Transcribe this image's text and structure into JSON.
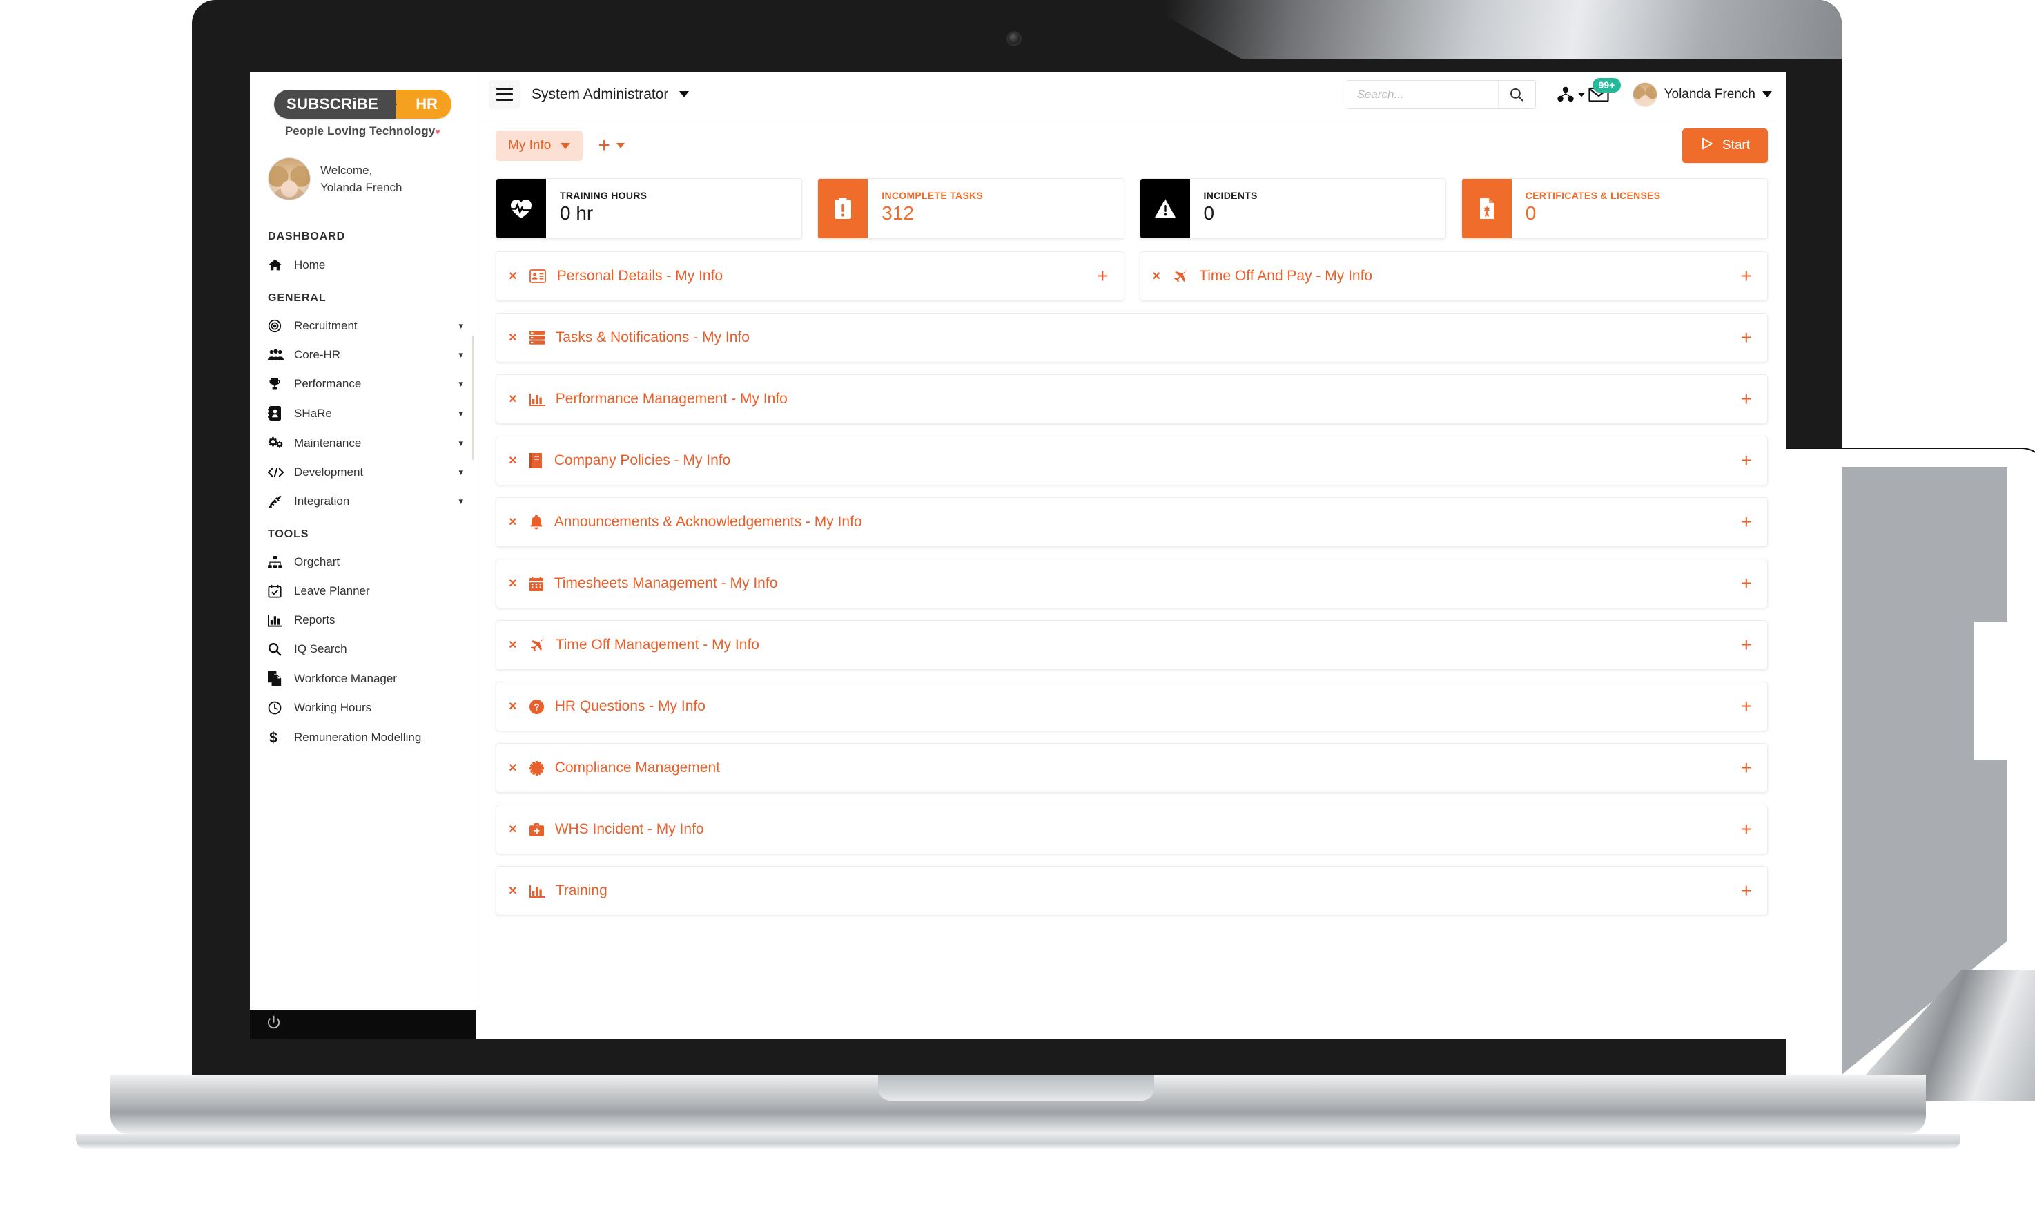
{
  "brand": {
    "logo_left": "SUBSCRiBE",
    "logo_right": "HR",
    "tagline": "People Loving Technology"
  },
  "welcome": {
    "greeting": "Welcome,",
    "user": "Yolanda French"
  },
  "sidebar": {
    "sections": [
      {
        "heading": "DASHBOARD",
        "items": [
          {
            "label": "Home",
            "icon": "home-icon",
            "expandable": false
          }
        ]
      },
      {
        "heading": "GENERAL",
        "items": [
          {
            "label": "Recruitment",
            "icon": "target-icon",
            "expandable": true
          },
          {
            "label": "Core-HR",
            "icon": "users-icon",
            "expandable": true
          },
          {
            "label": "Performance",
            "icon": "trophy-icon",
            "expandable": true
          },
          {
            "label": "SHaRe",
            "icon": "contact-card-icon",
            "expandable": true
          },
          {
            "label": "Maintenance",
            "icon": "gears-icon",
            "expandable": true
          },
          {
            "label": "Development",
            "icon": "code-icon",
            "expandable": true
          },
          {
            "label": "Integration",
            "icon": "plug-icon",
            "expandable": true
          }
        ]
      },
      {
        "heading": "TOOLS",
        "items": [
          {
            "label": "Orgchart",
            "icon": "org-tree-icon",
            "expandable": false
          },
          {
            "label": "Leave Planner",
            "icon": "calendar-check-icon",
            "expandable": false
          },
          {
            "label": "Reports",
            "icon": "bar-chart-icon",
            "expandable": false
          },
          {
            "label": "IQ Search",
            "icon": "magnifier-icon",
            "expandable": false
          },
          {
            "label": "Workforce Manager",
            "icon": "documents-icon",
            "expandable": false
          },
          {
            "label": "Working Hours",
            "icon": "clock-icon",
            "expandable": false
          },
          {
            "label": "Remuneration Modelling",
            "icon": "dollar-icon",
            "expandable": false
          }
        ]
      }
    ],
    "footer_icon": "power-icon"
  },
  "topbar": {
    "menu_icon": "hamburger-icon",
    "context_title": "System Administrator",
    "search": {
      "placeholder": "Search...",
      "value": "",
      "icon": "search-icon"
    },
    "apps_icon": "modules-icon",
    "mail_icon": "envelope-icon",
    "notification_badge": "99+",
    "user_name": "Yolanda French",
    "user_avatar": "avatar"
  },
  "toolbar": {
    "active_tab": "My Info",
    "add_label": "+",
    "start_label": "Start",
    "start_icon": "play-icon",
    "start_color": "#ef6c2b"
  },
  "stats": [
    {
      "label": "TRAINING HOURS",
      "value": "0 hr",
      "icon": "heartbeat-icon",
      "theme": "dark"
    },
    {
      "label": "INCOMPLETE TASKS",
      "value": "312",
      "icon": "clipboard-alert-icon",
      "theme": "orange"
    },
    {
      "label": "INCIDENTS",
      "value": "0",
      "icon": "warning-triangle-icon",
      "theme": "dark"
    },
    {
      "label": "CERTIFICATES & LICENSES",
      "value": "0",
      "icon": "certificate-icon",
      "theme": "orange"
    }
  ],
  "panel_rows": [
    [
      {
        "title": "Personal Details - My Info",
        "icon": "id-card-icon",
        "half": true
      },
      {
        "title": "Time Off And Pay - My Info",
        "icon": "plane-icon",
        "half": true
      }
    ],
    [
      {
        "title": "Tasks & Notifications - My Info",
        "icon": "list-icon",
        "half": false
      }
    ],
    [
      {
        "title": "Performance Management - My Info",
        "icon": "bar-chart-icon",
        "half": false
      }
    ],
    [
      {
        "title": "Company Policies - My Info",
        "icon": "book-icon",
        "half": false
      }
    ],
    [
      {
        "title": "Announcements & Acknowledgements - My Info",
        "icon": "bell-icon",
        "half": false
      }
    ],
    [
      {
        "title": "Timesheets Management - My Info",
        "icon": "calendar-icon",
        "half": false
      }
    ],
    [
      {
        "title": "Time Off Management - My Info",
        "icon": "plane-icon",
        "half": false
      }
    ],
    [
      {
        "title": "HR Questions - My Info",
        "icon": "question-circle-icon",
        "half": false
      }
    ],
    [
      {
        "title": "Compliance Management",
        "icon": "asterisk-icon",
        "half": false
      }
    ],
    [
      {
        "title": "WHS Incident - My Info",
        "icon": "first-aid-kit-icon",
        "half": false
      }
    ],
    [
      {
        "title": "Training",
        "icon": "bar-chart-icon",
        "half": false
      }
    ]
  ],
  "panel_controls": {
    "close": "×",
    "add": "+"
  },
  "colors": {
    "accent": "#ef6c2b",
    "panel_text": "#e8602c",
    "badge": "#26b99a",
    "logo_orange": "#f6a020"
  }
}
